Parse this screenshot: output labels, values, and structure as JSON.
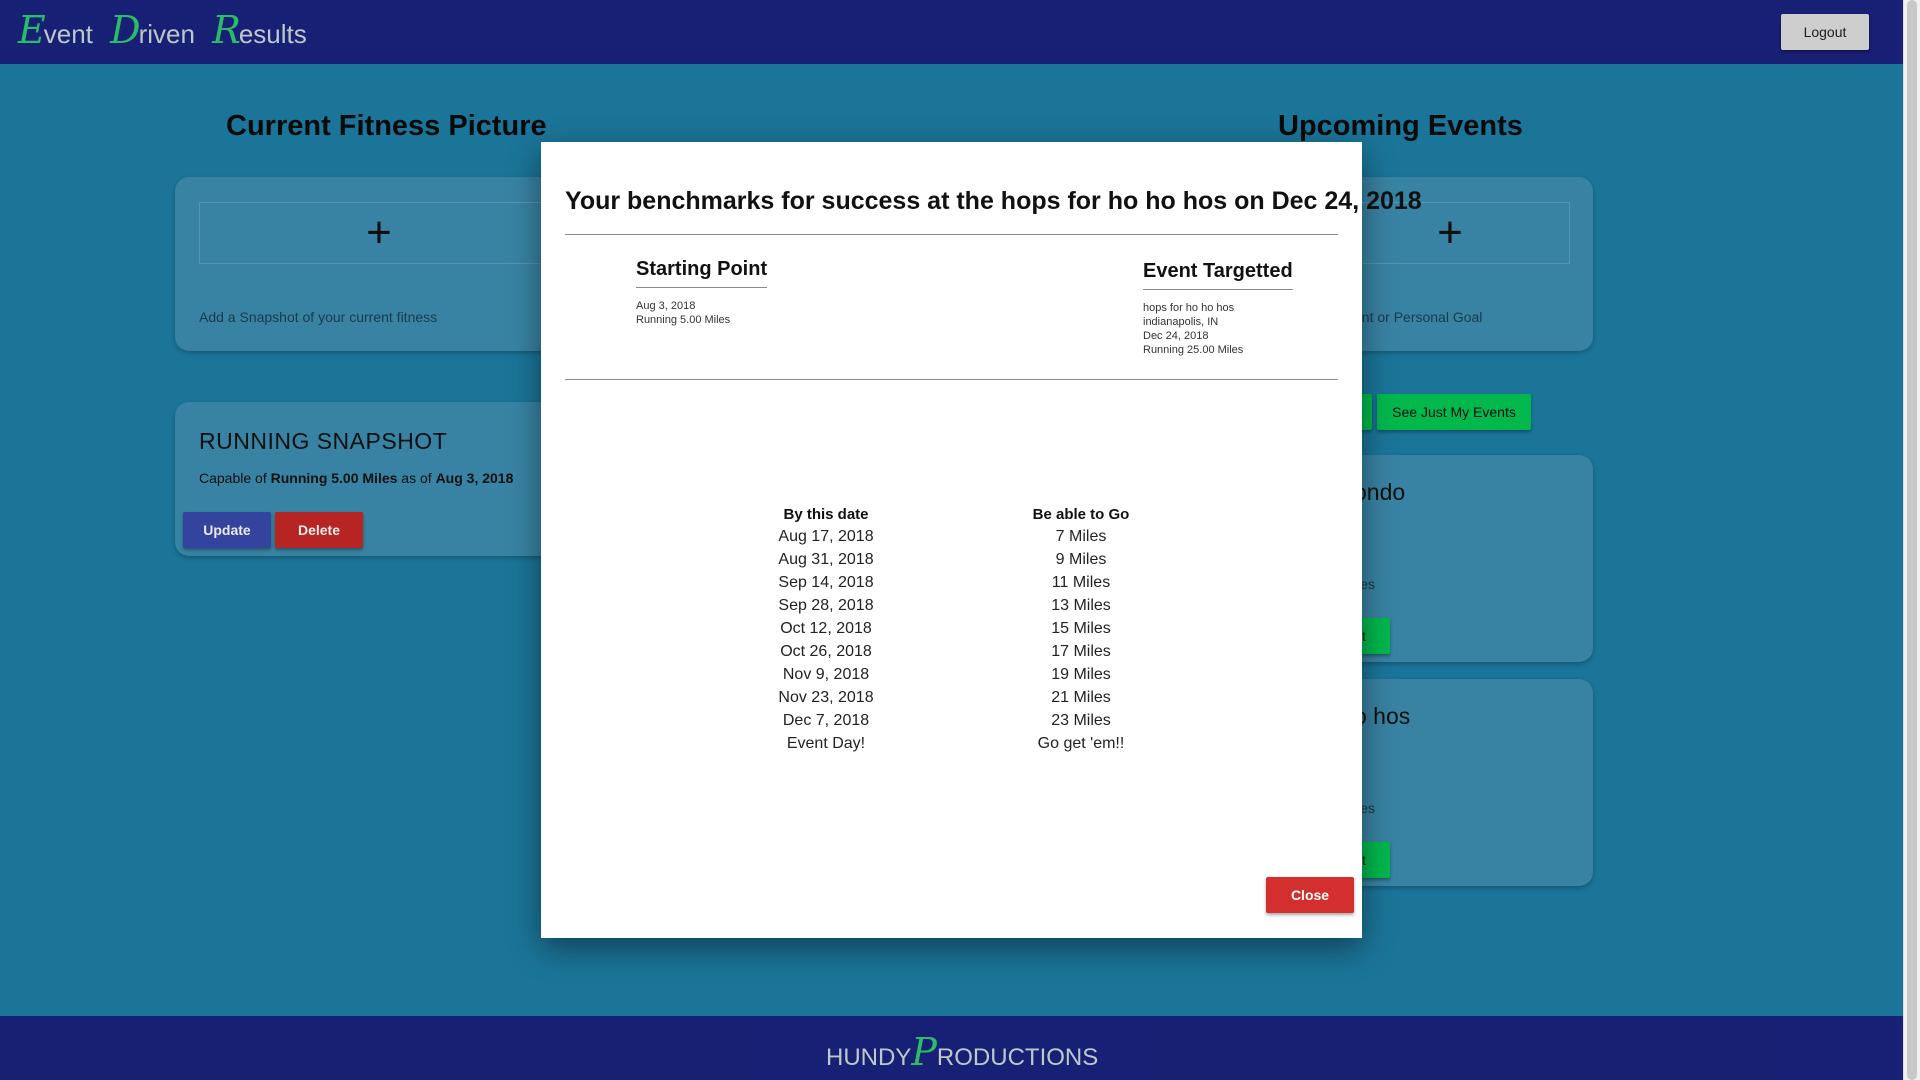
{
  "header": {
    "brand": [
      {
        "cap": "E",
        "rest": "vent"
      },
      {
        "cap": "D",
        "rest": "riven"
      },
      {
        "cap": "R",
        "rest": "esults"
      }
    ],
    "logout_label": "Logout"
  },
  "left": {
    "title": "Current Fitness Picture",
    "add_symbol": "+",
    "add_caption": "Add a Snapshot of your current fitness",
    "snapshot": {
      "title": "RUNNING SNAPSHOT",
      "prefix": "Capable of ",
      "activity": "Running 5.00 Miles",
      "middle": " as of ",
      "date": "Aug 3, 2018",
      "update_label": "Update",
      "delete_label": "Delete"
    }
  },
  "right": {
    "title": "Upcoming Events",
    "add_symbol": "+",
    "add_caption": "ent or Personal Goal",
    "filter_label": "See Just My Events",
    "events": [
      {
        "title_fragment": "ondo",
        "sub_fragment": "iles",
        "button_fragment": "nt"
      },
      {
        "title_fragment": "o hos",
        "sub_fragment": "iles",
        "button_fragment": "nt"
      }
    ]
  },
  "modal": {
    "title": "Your benchmarks for success at the hops for ho ho hos on Dec 24, 2018",
    "starting": {
      "heading": "Starting Point",
      "lines": [
        "Aug 3, 2018",
        "Running 5.00 Miles"
      ]
    },
    "target": {
      "heading": "Event Targetted",
      "lines": [
        "hops for ho ho hos",
        "indianapolis, IN",
        "Dec 24, 2018",
        "Running 25.00 Miles"
      ]
    },
    "schedule": {
      "col_date": "By this date",
      "col_goal": "Be able to Go",
      "rows": [
        {
          "date": "Aug 17, 2018",
          "goal": "7 Miles"
        },
        {
          "date": "Aug 31, 2018",
          "goal": "9 Miles"
        },
        {
          "date": "Sep 14, 2018",
          "goal": "11 Miles"
        },
        {
          "date": "Sep 28, 2018",
          "goal": "13 Miles"
        },
        {
          "date": "Oct 12, 2018",
          "goal": "15 Miles"
        },
        {
          "date": "Oct 26, 2018",
          "goal": "17 Miles"
        },
        {
          "date": "Nov 9, 2018",
          "goal": "19 Miles"
        },
        {
          "date": "Nov 23, 2018",
          "goal": "21 Miles"
        },
        {
          "date": "Dec 7, 2018",
          "goal": "23 Miles"
        },
        {
          "date": "Event Day!",
          "goal": "Go get 'em!!"
        }
      ]
    },
    "close_label": "Close"
  },
  "footer": {
    "prefix": "HUNDY",
    "cap": "P",
    "rest": "RODUCTIONS"
  },
  "colors": {
    "background": "#1e7fa6",
    "header": "#1a237e",
    "brand_accent": "#2ecc71",
    "update_button": "#3949ab",
    "delete_button": "#c62828",
    "filter_button": "#00c853",
    "close_button": "#d32f2f"
  }
}
